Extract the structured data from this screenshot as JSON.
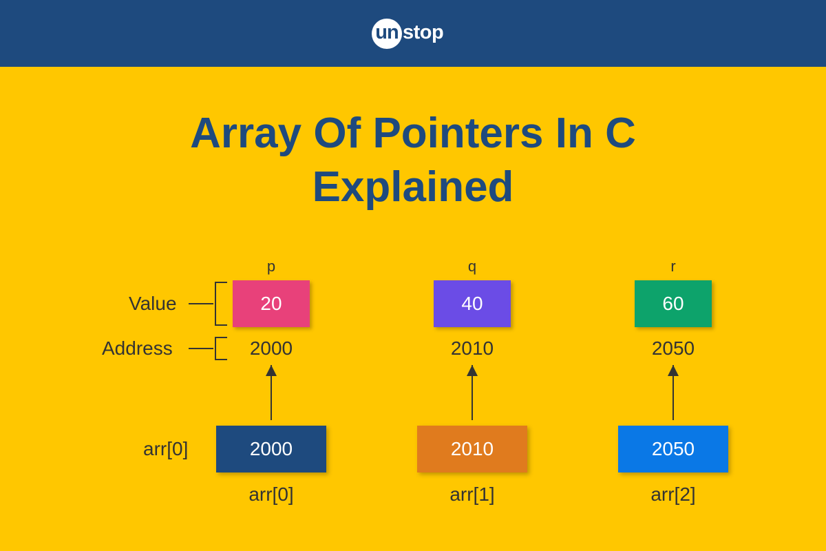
{
  "header": {
    "logo_un": "un",
    "logo_stop": "stop",
    "background": "#1E4A7E"
  },
  "title": {
    "line1": "Array Of Pointers In C",
    "line2": "Explained"
  },
  "legend": {
    "value_label": "Value",
    "address_label": "Address",
    "array_label": "arr[0]"
  },
  "variables": [
    {
      "name": "p",
      "value": "20",
      "address": "2000",
      "color": "#E8417A"
    },
    {
      "name": "q",
      "value": "40",
      "address": "2010",
      "color": "#6B4CE6"
    },
    {
      "name": "r",
      "value": "60",
      "address": "2050",
      "color": "#0DA36B"
    }
  ],
  "array": [
    {
      "label": "arr[0]",
      "value": "2000",
      "color": "#1E4A7E"
    },
    {
      "label": "arr[1]",
      "value": "2010",
      "color": "#E07B1E"
    },
    {
      "label": "arr[2]",
      "value": "2050",
      "color": "#0A78E6"
    }
  ]
}
